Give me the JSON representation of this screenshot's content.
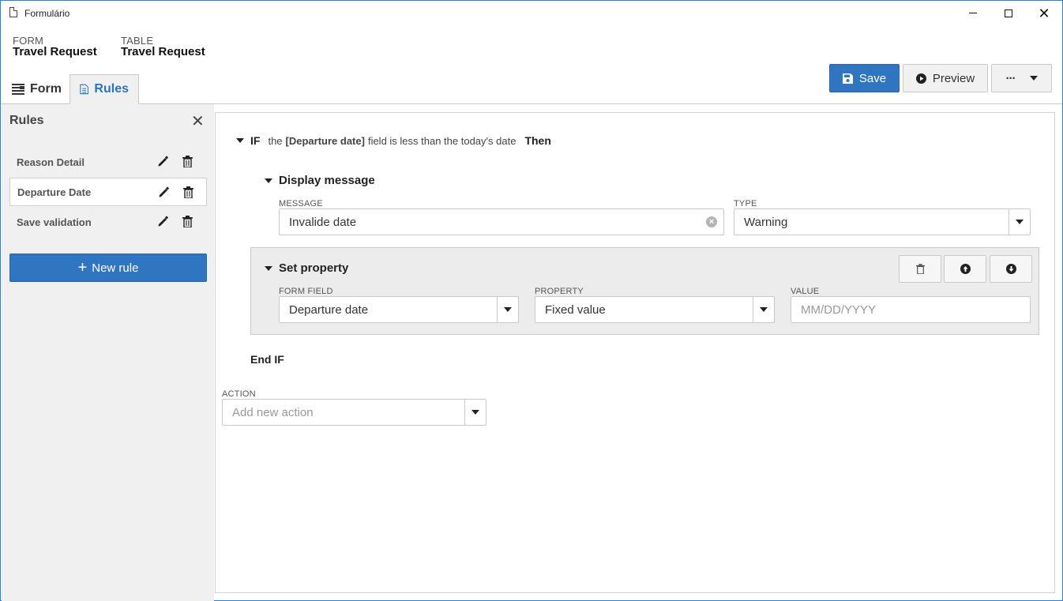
{
  "window": {
    "title": "Formulário"
  },
  "header": {
    "form_label": "FORM",
    "form_value": "Travel Request",
    "table_label": "TABLE",
    "table_value": "Travel Request"
  },
  "tabs": [
    {
      "label": "Form",
      "icon": "form-list-icon"
    },
    {
      "label": "Rules",
      "icon": "document-icon",
      "active": true
    }
  ],
  "toolbar": {
    "save_label": "Save",
    "preview_label": "Preview",
    "more_label": "···"
  },
  "sidebar": {
    "title": "Rules",
    "items": [
      {
        "label": "Reason Detail"
      },
      {
        "label": "Departure Date",
        "active": true
      },
      {
        "label": "Save validation"
      }
    ],
    "new_rule_label": "New rule"
  },
  "rule": {
    "if_keyword": "IF",
    "condition_prefix": "the",
    "condition_field": "[Departure date]",
    "condition_suffix": "field is less than the today's date",
    "then_keyword": "Then",
    "display_message": {
      "title": "Display message",
      "message_label": "MESSAGE",
      "message_value": "Invalide date",
      "type_label": "TYPE",
      "type_value": "Warning"
    },
    "set_property": {
      "title": "Set property",
      "form_field_label": "FORM FIELD",
      "form_field_value": "Departure date",
      "property_label": "PROPERTY",
      "property_value": "Fixed value",
      "value_label": "VALUE",
      "value_placeholder": "MM/DD/YYYY"
    },
    "end_keyword": "End IF"
  },
  "action": {
    "label": "ACTION",
    "placeholder": "Add new action"
  },
  "colors": {
    "accent": "#2f75c0",
    "tab_active_text": "#2a74bb"
  }
}
